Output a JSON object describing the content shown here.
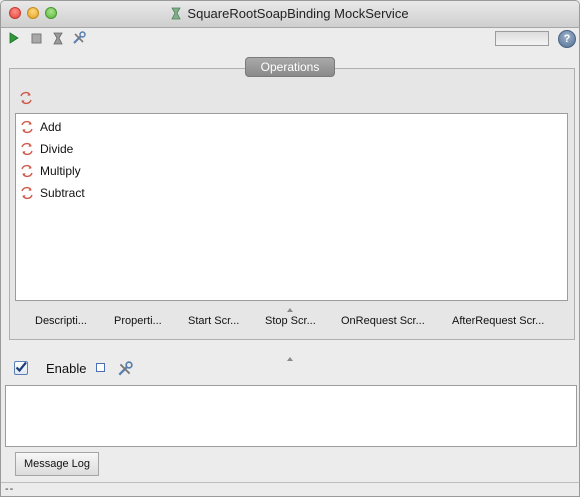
{
  "window": {
    "title": "SquareRootSoapBinding MockService"
  },
  "toolbar": {
    "icons": [
      "play-icon",
      "stop-icon",
      "options-icon",
      "tools-icon"
    ],
    "help_label": "?"
  },
  "operations": {
    "tab_label": "Operations",
    "items": [
      {
        "label": "Add",
        "icon": "operation-icon"
      },
      {
        "label": "Divide",
        "icon": "operation-icon"
      },
      {
        "label": "Multiply",
        "icon": "operation-icon"
      },
      {
        "label": "Subtract",
        "icon": "operation-icon"
      }
    ]
  },
  "detail_tabs": [
    "Descripti...",
    "Properti...",
    "Start Scr...",
    "Stop Scr...",
    "OnRequest Scr...",
    "AfterRequest Scr..."
  ],
  "script_panel": {
    "enable_label": "Enable",
    "enable_checked": true
  },
  "bottom": {
    "message_log_label": "Message Log",
    "status_text": "--"
  },
  "colors": {
    "operation_icon": "#d05a4a",
    "play_icon": "#2e9a3a",
    "tab_bg": "#8f8f8f"
  }
}
